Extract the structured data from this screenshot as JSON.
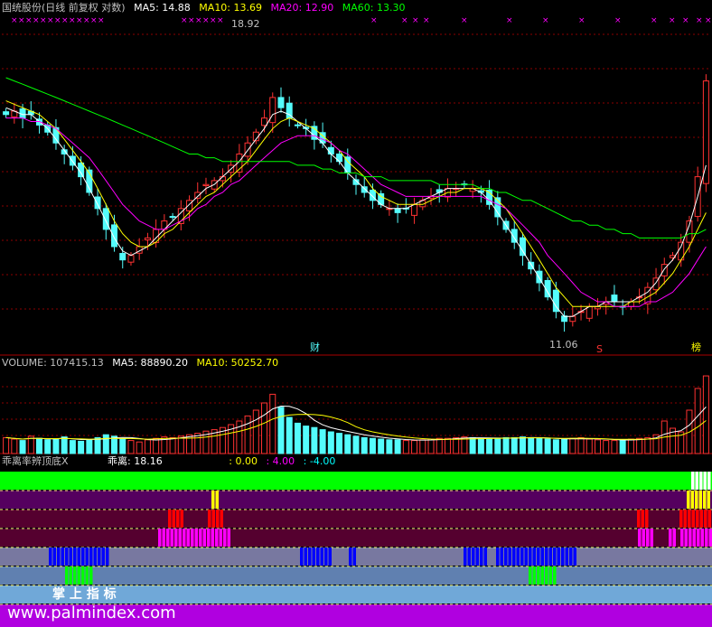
{
  "header": {
    "title": "国统股份(日线 前复权 对数)",
    "ma5_label": "MA5: 14.88",
    "ma10_label": "MA10: 13.69",
    "ma20_label": "MA20: 12.90",
    "ma60_label": "MA60: 13.30"
  },
  "volume_header": {
    "volume_label": "VOLUME: 107415.13",
    "ma5_label": "MA5: 88890.20",
    "ma10_label": "MA10: 50252.70"
  },
  "indicator_header": {
    "name": "乖离率辨顶底X",
    "value_label": "乖离: 18.16",
    "v1": ": 0.00",
    "v2": ": 4.00",
    "v3": ": -4.00"
  },
  "annotations": {
    "high_label": "18.92",
    "low_label": "11.06",
    "marker_cai": "财",
    "marker_s": "S",
    "marker_bang": "榜"
  },
  "watermark": {
    "brand": "掌 上 指 标",
    "url": "www.palmindex.com"
  },
  "colors": {
    "up": "#ff3232",
    "down": "#54fcfc",
    "ma5": "#ffffff",
    "ma10": "#ffff00",
    "ma20": "#ff00ff",
    "ma60": "#00ff00",
    "grid": "#8b0000"
  },
  "chart_data": [
    {
      "type": "candlestick",
      "title": "国统股份(日线 前复权 对数)",
      "ylim": [
        10.8,
        19.4
      ],
      "y_scale": "log",
      "grid": true,
      "series": [
        {
          "name": "MA5",
          "last": 14.88
        },
        {
          "name": "MA10",
          "last": 13.69
        },
        {
          "name": "MA20",
          "last": 12.9
        },
        {
          "name": "MA60",
          "last": 13.3
        }
      ],
      "close": [
        16.3,
        16.4,
        16.2,
        16.3,
        16.0,
        15.8,
        15.5,
        15.2,
        14.9,
        14.6,
        14.2,
        13.8,
        13.3,
        12.9,
        12.6,
        12.7,
        12.9,
        13.1,
        13.3,
        13.5,
        13.6,
        13.8,
        14.0,
        14.2,
        14.4,
        14.5,
        14.6,
        14.9,
        15.2,
        15.5,
        15.8,
        16.2,
        16.8,
        16.5,
        16.2,
        16.0,
        15.9,
        15.6,
        15.5,
        15.2,
        15.0,
        14.7,
        14.4,
        14.2,
        14.0,
        13.9,
        13.8,
        13.7,
        13.8,
        13.9,
        14.0,
        14.1,
        14.2,
        14.3,
        14.3,
        14.4,
        14.3,
        14.2,
        13.9,
        13.6,
        13.3,
        13.0,
        12.7,
        12.4,
        12.1,
        11.8,
        11.5,
        11.3,
        11.4,
        11.5,
        11.6,
        11.6,
        11.7,
        11.7,
        11.6,
        11.7,
        11.8,
        12.0,
        12.2,
        12.5,
        12.7,
        13.0,
        13.5,
        14.6,
        17.3
      ],
      "ma5": [
        16.5,
        16.4,
        16.3,
        16.3,
        16.1,
        15.9,
        15.6,
        15.3,
        15.0,
        14.7,
        14.3,
        13.9,
        13.5,
        13.1,
        12.8,
        12.7,
        12.8,
        12.9,
        13.1,
        13.3,
        13.5,
        13.7,
        13.9,
        14.1,
        14.3,
        14.4,
        14.6,
        14.8,
        15.0,
        15.3,
        15.6,
        15.9,
        16.3,
        16.4,
        16.3,
        16.1,
        15.9,
        15.7,
        15.5,
        15.2,
        15.0,
        14.7,
        14.5,
        14.3,
        14.1,
        13.9,
        13.8,
        13.8,
        13.8,
        13.9,
        14.0,
        14.1,
        14.2,
        14.3,
        14.3,
        14.3,
        14.3,
        14.2,
        14.0,
        13.7,
        13.4,
        13.1,
        12.8,
        12.5,
        12.2,
        11.9,
        11.6,
        11.4,
        11.4,
        11.5,
        11.6,
        11.6,
        11.7,
        11.7,
        11.7,
        11.7,
        11.8,
        11.9,
        12.1,
        12.4,
        12.6,
        12.9,
        13.4,
        14.1,
        14.9
      ],
      "ma10": [
        16.7,
        16.6,
        16.5,
        16.4,
        16.3,
        16.1,
        15.9,
        15.6,
        15.3,
        15.0,
        14.7,
        14.3,
        13.9,
        13.5,
        13.2,
        13.0,
        12.9,
        12.9,
        13.0,
        13.2,
        13.3,
        13.5,
        13.7,
        13.9,
        14.1,
        14.2,
        14.4,
        14.6,
        14.8,
        15.0,
        15.3,
        15.6,
        15.9,
        16.1,
        16.2,
        16.1,
        16.0,
        15.9,
        15.7,
        15.5,
        15.3,
        15.0,
        14.8,
        14.6,
        14.3,
        14.1,
        14.0,
        13.9,
        13.9,
        13.9,
        13.9,
        14.0,
        14.1,
        14.2,
        14.2,
        14.3,
        14.3,
        14.3,
        14.2,
        14.0,
        13.8,
        13.5,
        13.2,
        12.9,
        12.6,
        12.3,
        12.0,
        11.8,
        11.6,
        11.6,
        11.6,
        11.6,
        11.6,
        11.6,
        11.6,
        11.7,
        11.7,
        11.8,
        11.9,
        12.1,
        12.3,
        12.6,
        12.9,
        13.3,
        13.7
      ],
      "ma20": [
        16.2,
        16.2,
        16.2,
        16.1,
        16.1,
        16.0,
        15.9,
        15.7,
        15.5,
        15.3,
        15.1,
        14.8,
        14.5,
        14.2,
        13.9,
        13.7,
        13.5,
        13.4,
        13.3,
        13.3,
        13.4,
        13.5,
        13.6,
        13.8,
        13.9,
        14.1,
        14.2,
        14.4,
        14.5,
        14.7,
        14.9,
        15.1,
        15.3,
        15.5,
        15.6,
        15.7,
        15.7,
        15.7,
        15.6,
        15.5,
        15.3,
        15.2,
        15.0,
        14.8,
        14.6,
        14.4,
        14.3,
        14.2,
        14.1,
        14.1,
        14.1,
        14.1,
        14.1,
        14.1,
        14.1,
        14.1,
        14.1,
        14.1,
        14.0,
        13.9,
        13.8,
        13.6,
        13.4,
        13.2,
        13.0,
        12.7,
        12.5,
        12.3,
        12.1,
        11.9,
        11.8,
        11.7,
        11.7,
        11.6,
        11.6,
        11.6,
        11.6,
        11.7,
        11.7,
        11.8,
        11.9,
        12.1,
        12.3,
        12.6,
        12.9
      ],
      "ma60": [
        17.4,
        17.3,
        17.2,
        17.1,
        17.0,
        16.9,
        16.8,
        16.7,
        16.6,
        16.5,
        16.4,
        16.3,
        16.2,
        16.1,
        16.0,
        15.9,
        15.8,
        15.7,
        15.6,
        15.5,
        15.4,
        15.3,
        15.2,
        15.2,
        15.1,
        15.1,
        15.0,
        15.0,
        15.0,
        15.0,
        15.0,
        15.0,
        15.0,
        15.0,
        15.0,
        14.9,
        14.9,
        14.9,
        14.8,
        14.8,
        14.7,
        14.7,
        14.7,
        14.6,
        14.6,
        14.6,
        14.5,
        14.5,
        14.5,
        14.5,
        14.5,
        14.5,
        14.4,
        14.4,
        14.4,
        14.4,
        14.4,
        14.3,
        14.3,
        14.2,
        14.2,
        14.1,
        14.0,
        14.0,
        13.9,
        13.8,
        13.7,
        13.6,
        13.5,
        13.5,
        13.4,
        13.4,
        13.3,
        13.3,
        13.2,
        13.2,
        13.1,
        13.1,
        13.1,
        13.1,
        13.1,
        13.1,
        13.2,
        13.2,
        13.3
      ],
      "annotations": [
        {
          "label": "18.92",
          "value": 18.92
        },
        {
          "label": "11.06",
          "value": 11.06
        }
      ]
    },
    {
      "type": "bar",
      "title": "VOLUME",
      "series": [
        {
          "name": "VOLUME",
          "last": 107415.13
        },
        {
          "name": "MA5",
          "last": 88890.2
        },
        {
          "name": "MA10",
          "last": 50252.7
        }
      ],
      "values": [
        22000,
        20000,
        18000,
        24000,
        21000,
        19000,
        20000,
        23000,
        18000,
        17000,
        19000,
        22000,
        26000,
        24000,
        20000,
        18000,
        16000,
        19000,
        21000,
        23000,
        22000,
        24000,
        26000,
        28000,
        31000,
        33000,
        36000,
        40000,
        45000,
        52000,
        60000,
        70000,
        82000,
        64000,
        50000,
        42000,
        38000,
        36000,
        33000,
        30000,
        28000,
        26000,
        24000,
        22000,
        21000,
        20000,
        19000,
        19000,
        18000,
        18000,
        19000,
        20000,
        21000,
        21000,
        22000,
        23000,
        22000,
        21000,
        20000,
        21000,
        22000,
        22000,
        23000,
        22000,
        21000,
        20000,
        19000,
        20000,
        21000,
        22000,
        20000,
        19000,
        18000,
        18000,
        19000,
        20000,
        21000,
        22000,
        26000,
        45000,
        35000,
        30000,
        60000,
        90000,
        107415
      ]
    }
  ]
}
